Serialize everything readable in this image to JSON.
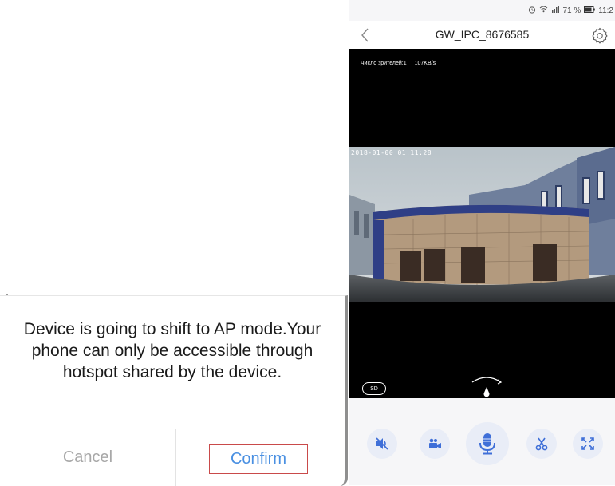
{
  "dialog": {
    "message": "Device is going to shift to AP mode.Your phone can only be accessible through hotspot shared by the device.",
    "cancel_label": "Cancel",
    "confirm_label": "Confirm"
  },
  "statusbar": {
    "alarm_icon": "alarm-clock-icon",
    "wifi_icon": "wifi-icon",
    "signal_icon": "signal-icon",
    "battery_text": "71 %",
    "battery_icon": "battery-icon",
    "time": "11:2"
  },
  "navbar": {
    "title": "GW_IPC_8676585",
    "back_icon": "chevron-left-icon",
    "settings_icon": "gear-icon"
  },
  "video": {
    "viewers_label": "Число зрителей:1",
    "bitrate": "107KB/s",
    "timestamp": "2018-01-00 01:11:28",
    "sd_label": "SD",
    "ptz_icon": "ptz-direction-icon"
  },
  "controls": {
    "buttons": [
      {
        "name": "mute",
        "icon": "speaker-mute-icon"
      },
      {
        "name": "record",
        "icon": "video-camera-icon"
      },
      {
        "name": "talk",
        "icon": "microphone-icon"
      },
      {
        "name": "screenshot",
        "icon": "scissors-icon"
      },
      {
        "name": "fullscreen",
        "icon": "fullscreen-icon"
      }
    ]
  },
  "colors": {
    "accent": "#4a90e2",
    "control_bg": "#e9edf7",
    "confirm_border": "#c94a4a"
  }
}
